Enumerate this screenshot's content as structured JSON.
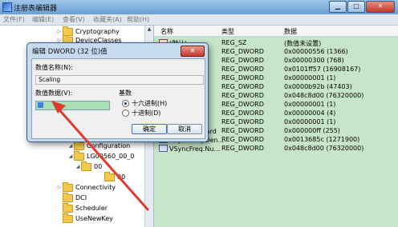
{
  "window": {
    "title": "注册表编辑器",
    "caption": {
      "minimize": "▁",
      "maximize": "□",
      "close": "✕"
    }
  },
  "menu": [
    "文件(F)",
    "编辑(E)",
    "查看(V)",
    "收藏夹(A)",
    "帮助(H)"
  ],
  "tree": {
    "items": [
      {
        "label": "Cryptography",
        "expander": "▷"
      },
      {
        "label": "DeviceClasses",
        "expander": "▷"
      },
      {
        "label": "Configuration",
        "expander": "◢"
      },
      {
        "label": "LG00560_00_0",
        "expander": "◢"
      },
      {
        "label": "00",
        "expander": "◢"
      },
      {
        "label": "00",
        "expander": ""
      },
      {
        "label": "Connectivity",
        "expander": "▷"
      },
      {
        "label": "DCI",
        "expander": ""
      },
      {
        "label": "Scheduler",
        "expander": ""
      },
      {
        "label": "UseNewKey",
        "expander": ""
      }
    ]
  },
  "list": {
    "headers": {
      "name": "名称",
      "type": "类型",
      "data": "数据"
    },
    "rows": [
      {
        "name": "(默认)",
        "type": "REG_SZ",
        "data": "(数值未设置)",
        "icon": "string-value-icon"
      },
      {
        "name": "",
        "type": "REG_DWORD",
        "data": "0x00000556 (1366)",
        "icon": "dword-value-icon"
      },
      {
        "name": "",
        "type": "REG_DWORD",
        "data": "0x00000300 (768)",
        "icon": "dword-value-icon"
      },
      {
        "name": "",
        "type": "REG_DWORD",
        "data": "0x0101ff57 (16908167)",
        "icon": "dword-value-icon"
      },
      {
        "name": "...en...",
        "type": "REG_DWORD",
        "data": "0x00000001 (1)",
        "icon": "dword-value-icon"
      },
      {
        "name": "",
        "type": "REG_DWORD",
        "data": "0x0000b92b (47403)",
        "icon": "dword-value-icon"
      },
      {
        "name": "",
        "type": "REG_DWORD",
        "data": "0x048c8d00 (76320000)",
        "icon": "dword-value-icon"
      },
      {
        "name": "",
        "type": "REG_DWORD",
        "data": "0x00000001 (1)",
        "icon": "dword-value-icon"
      },
      {
        "name": "",
        "type": "REG_DWORD",
        "data": "0x00000004 (4)",
        "icon": "dword-value-icon"
      },
      {
        "name": "...",
        "type": "REG_DWORD",
        "data": "0x00000001 (1)",
        "icon": "dword-value-icon"
      },
      {
        "name": "VideoStandard",
        "type": "REG_DWORD",
        "data": "0x000000ff (255)",
        "icon": "dword-value-icon"
      },
      {
        "name": "VSyncFreq.Den...",
        "type": "REG_DWORD",
        "data": "0x0013685c (1271900)",
        "icon": "dword-value-icon"
      },
      {
        "name": "VSyncFreq.Nu...",
        "type": "REG_DWORD",
        "data": "0x048c8d00 (76320000)",
        "icon": "dword-value-icon"
      }
    ]
  },
  "dialog": {
    "title": "编辑 DWORD (32 位)值",
    "close": "✕",
    "name_label": "数值名称(N):",
    "name_value": "Scaling",
    "data_label": "数值数据(V):",
    "data_value": "",
    "base_label": "基数",
    "radix": [
      {
        "label": "十六进制(H)",
        "selected": true
      },
      {
        "label": "十进制(D)",
        "selected": false
      }
    ],
    "ok": "确定",
    "cancel": "取消"
  },
  "colors": {
    "annotation_arrow": "#e03a2a",
    "list_background": "#c7e6c9",
    "input_highlight": "#a8e0b4"
  }
}
